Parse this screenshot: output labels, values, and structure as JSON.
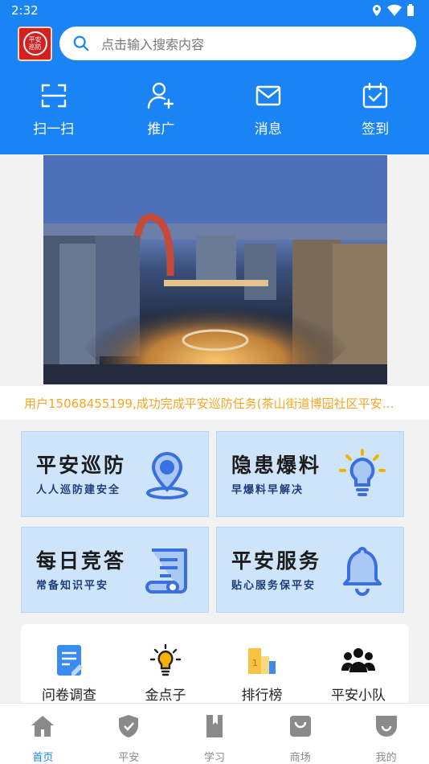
{
  "status_bar": {
    "time": "2:32"
  },
  "search": {
    "placeholder": "点击输入搜索内容"
  },
  "logo": {
    "text": "平安\n巡防"
  },
  "quick_actions": [
    {
      "label": "扫一扫",
      "icon": "scan-icon"
    },
    {
      "label": "推广",
      "icon": "add-user-icon"
    },
    {
      "label": "消息",
      "icon": "mail-icon"
    },
    {
      "label": "签到",
      "icon": "calendar-check-icon"
    }
  ],
  "notice": {
    "text": "用户15068455199,成功完成平安巡防任务(茶山街道博园社区平安…"
  },
  "cards": [
    {
      "title": "平安巡防",
      "subtitle": "人人巡防建安全",
      "icon": "location-pin-icon"
    },
    {
      "title": "隐患爆料",
      "subtitle": "早爆料早解决",
      "icon": "lightbulb-icon"
    },
    {
      "title": "每日竞答",
      "subtitle": "常备知识平安",
      "icon": "scroll-icon"
    },
    {
      "title": "平安服务",
      "subtitle": "贴心服务保平安",
      "icon": "bell-icon"
    }
  ],
  "tools": [
    {
      "label": "问卷调查",
      "icon": "questionnaire-icon",
      "badge": ""
    },
    {
      "label": "金点子",
      "icon": "lightbulb-idea-icon",
      "badge": ""
    },
    {
      "label": "排行榜",
      "icon": "ranking-icon",
      "badge": "1"
    },
    {
      "label": "平安小队",
      "icon": "team-icon",
      "badge": ""
    }
  ],
  "tabs": [
    {
      "label": "首页",
      "icon": "home-icon",
      "active": true
    },
    {
      "label": "平安",
      "icon": "shield-icon",
      "active": false
    },
    {
      "label": "学习",
      "icon": "book-icon",
      "active": false
    },
    {
      "label": "商场",
      "icon": "shopping-bag-icon",
      "active": false
    },
    {
      "label": "我的",
      "icon": "profile-icon",
      "active": false
    }
  ],
  "colors": {
    "primary": "#1a84f5",
    "notice": "#f5a623",
    "card_bg": "#cde4fb"
  }
}
